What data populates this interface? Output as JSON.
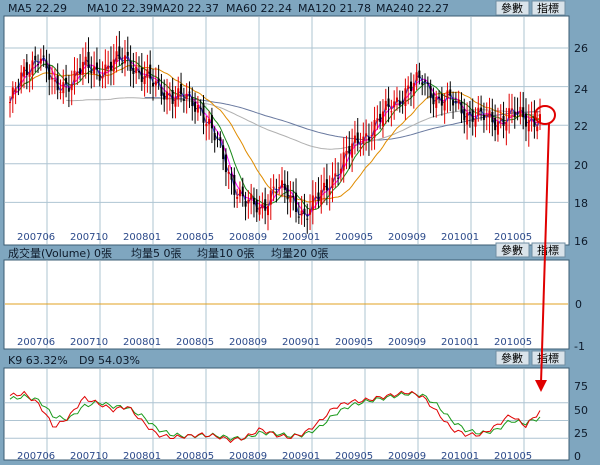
{
  "colors": {
    "ma5": "#2c3fd6",
    "ma10": "#ff00ff",
    "ma20": "#1a8a1a",
    "ma60": "#e08c00",
    "ma120": "#b0b0b0",
    "ma240": "#6a7aa0",
    "up_candle": "#e00000",
    "down_candle": "#000000",
    "volume_line": "#e0a020",
    "k_line": "#e00000",
    "d_line": "#1a9a1a",
    "annotation": "#e00000"
  },
  "buttons": {
    "params": "參數",
    "indicator": "指標"
  },
  "price_panel": {
    "legend": [
      {
        "label": "MA5",
        "value": "22.29"
      },
      {
        "label": "MA10",
        "value": "22.39"
      },
      {
        "label": "MA20",
        "value": "22.37"
      },
      {
        "label": "MA60",
        "value": "22.24"
      },
      {
        "label": "MA120",
        "value": "21.78"
      },
      {
        "label": "MA240",
        "value": "22.27"
      }
    ],
    "y_ticks": [
      "26",
      "24",
      "22",
      "20",
      "18",
      "16"
    ]
  },
  "volume_panel": {
    "legend": [
      "成交量(Volume) 0張",
      "均量5 0張",
      "均量10 0張",
      "均量20 0張"
    ],
    "y_ticks": [
      "0",
      "-1"
    ]
  },
  "kd_panel": {
    "legend": [
      "K9 63.32%",
      "D9 54.03%"
    ],
    "y_ticks": [
      "75",
      "50",
      "25",
      "0"
    ]
  },
  "x_ticks": [
    "200706",
    "200710",
    "200801",
    "200805",
    "200809",
    "200901",
    "200905",
    "200909",
    "201001",
    "201005"
  ],
  "chart_data": [
    {
      "type": "candlestick",
      "ylim": [
        16,
        27
      ],
      "y_ticks": [
        26,
        24,
        22,
        20,
        18,
        16
      ],
      "x_tick_labels": [
        "200706",
        "200710",
        "200801",
        "200805",
        "200809",
        "200901",
        "200905",
        "200909",
        "201001",
        "201005"
      ],
      "series": [
        {
          "name": "MA5",
          "last": 22.29
        },
        {
          "name": "MA10",
          "last": 22.39
        },
        {
          "name": "MA20",
          "last": 22.37
        },
        {
          "name": "MA60",
          "last": 22.24
        },
        {
          "name": "MA120",
          "last": 21.78
        },
        {
          "name": "MA240",
          "last": 22.27
        }
      ],
      "close_approx": {
        "x": [
          "200705",
          "200706",
          "200707",
          "200708",
          "200709",
          "200710",
          "200711",
          "200712",
          "200801",
          "200802",
          "200803",
          "200804",
          "200805",
          "200806",
          "200807",
          "200808",
          "200809",
          "200810",
          "200811",
          "200812",
          "200901",
          "200902",
          "200903",
          "200904",
          "200905",
          "200906",
          "200907",
          "200908",
          "200909",
          "200910",
          "200911",
          "200912",
          "201001",
          "201002",
          "201003",
          "201004",
          "201005"
        ],
        "y": [
          23.2,
          24.7,
          25.8,
          23.8,
          24.3,
          25.0,
          24.8,
          25.2,
          25.4,
          24.6,
          23.9,
          23.6,
          23.3,
          22.9,
          21.2,
          19.2,
          18.0,
          17.6,
          18.9,
          18.2,
          17.4,
          18.2,
          19.4,
          20.6,
          21.4,
          22.2,
          23.1,
          23.9,
          24.3,
          23.4,
          23.2,
          22.7,
          22.4,
          22.2,
          22.6,
          22.3,
          22.4
        ]
      }
    },
    {
      "type": "line",
      "ylim": [
        -1,
        1
      ],
      "y_ticks": [
        0,
        -1
      ],
      "series": [
        {
          "name": "成交量(Volume)",
          "values": [
            0,
            0
          ]
        }
      ]
    },
    {
      "type": "line",
      "ylim": [
        0,
        100
      ],
      "y_ticks": [
        75,
        50,
        25,
        0
      ],
      "x": [
        "200705",
        "200706",
        "200707",
        "200708",
        "200709",
        "200710",
        "200711",
        "200712",
        "200801",
        "200802",
        "200803",
        "200804",
        "200805",
        "200806",
        "200807",
        "200808",
        "200809",
        "200810",
        "200811",
        "200812",
        "200901",
        "200902",
        "200903",
        "200904",
        "200905",
        "200906",
        "200907",
        "200908",
        "200909",
        "200910",
        "200911",
        "200912",
        "201001",
        "201002",
        "201003",
        "201004",
        "201005"
      ],
      "series": [
        {
          "name": "K9",
          "last": 63.32,
          "values": [
            85,
            88,
            72,
            40,
            55,
            82,
            74,
            65,
            70,
            48,
            30,
            26,
            28,
            30,
            28,
            22,
            26,
            38,
            30,
            26,
            32,
            48,
            68,
            76,
            78,
            82,
            86,
            90,
            84,
            62,
            38,
            30,
            30,
            42,
            58,
            42,
            63
          ]
        },
        {
          "name": "D9",
          "last": 54.03,
          "values": [
            80,
            84,
            78,
            55,
            52,
            70,
            76,
            70,
            68,
            56,
            38,
            30,
            28,
            29,
            29,
            25,
            25,
            33,
            32,
            28,
            30,
            40,
            58,
            70,
            76,
            80,
            84,
            88,
            86,
            72,
            50,
            36,
            32,
            36,
            50,
            46,
            54
          ]
        }
      ]
    }
  ]
}
